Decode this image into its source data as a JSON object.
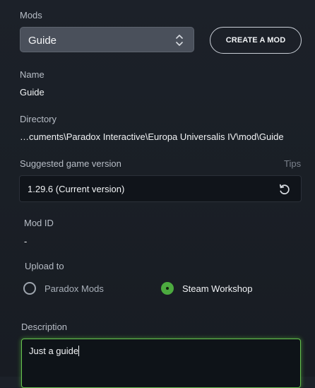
{
  "mods": {
    "label": "Mods",
    "selected": "Guide",
    "create_label": "CREATE A MOD"
  },
  "name": {
    "label": "Name",
    "value": "Guide"
  },
  "directory": {
    "label": "Directory",
    "value": "…cuments\\Paradox Interactive\\Europa Universalis IV\\mod\\Guide"
  },
  "game_version": {
    "label": "Suggested game version",
    "tips_label": "Tips",
    "value": "1.29.6 (Current version)"
  },
  "mod_id": {
    "label": "Mod ID",
    "value": "-"
  },
  "upload": {
    "label": "Upload to",
    "options": [
      {
        "label": "Paradox Mods",
        "selected": false
      },
      {
        "label": "Steam Workshop",
        "selected": true
      }
    ]
  },
  "description": {
    "label": "Description",
    "value": "Just a guide"
  },
  "colors": {
    "accent_green": "#4caa3f",
    "focus_border": "#67c44f"
  }
}
